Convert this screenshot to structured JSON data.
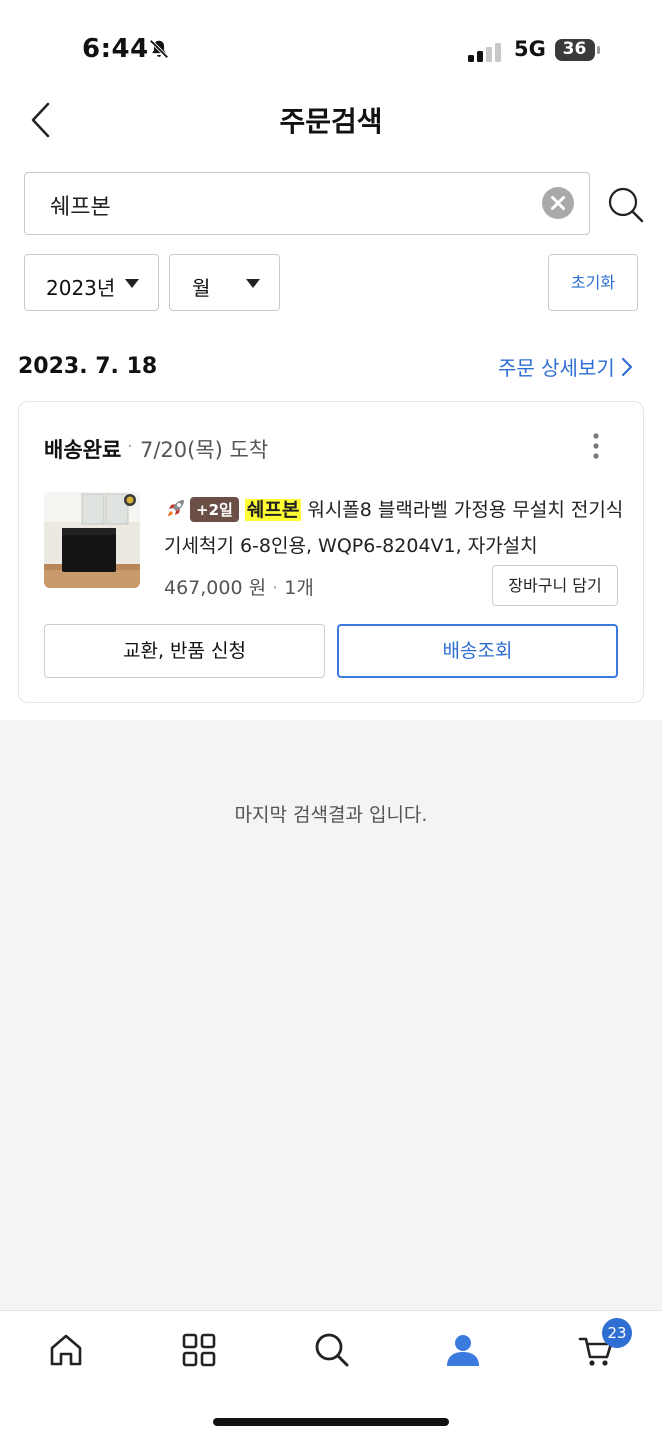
{
  "status_bar": {
    "time": "6:44",
    "network": "5G",
    "battery": "36"
  },
  "header": {
    "title": "주문검색"
  },
  "search": {
    "query": "쉐프본"
  },
  "filters": {
    "year": "2023년",
    "month": "월",
    "reset_label": "초기화"
  },
  "order": {
    "date": "2023. 7. 18",
    "detail_link": "주문 상세보기",
    "status": "배송완료",
    "separator": "·",
    "arrival": "7/20(목) 도착",
    "item": {
      "badge": "+2일",
      "highlight": "쉐프본",
      "name_rest_line1": " 워시폴8 블랙라벨 가정용 무설치 전기식",
      "name_line2": "기세척기 6-8인용, WQP6-8204V1, 자가설치",
      "price": "467,000 원",
      "qty_sep": "·",
      "quantity": "1개",
      "add_to_cart_label": "장바구니 담기"
    },
    "buttons": {
      "return": "교환, 반품 신청",
      "track": "배송조회"
    }
  },
  "end_message": "마지막 검색결과 입니다.",
  "bottom_nav": {
    "items": [
      "home-icon",
      "category-icon",
      "search-icon",
      "my-page-icon",
      "cart-icon"
    ],
    "cart_count": "23",
    "active_color": "#3b7be0"
  },
  "colors": {
    "accent": "#2f6fd3",
    "highlight": "#ffff33",
    "badge": "#6b4e45"
  }
}
